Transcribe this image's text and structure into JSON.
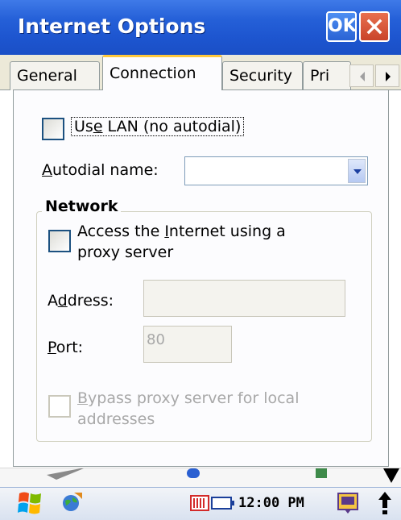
{
  "window": {
    "title": "Internet Options",
    "ok_label": "OK"
  },
  "tabs": [
    {
      "label": "General",
      "active": false
    },
    {
      "label": "Connection",
      "active": true
    },
    {
      "label": "Security",
      "active": false
    },
    {
      "label": "Pri",
      "active": false
    }
  ],
  "connection": {
    "use_lan": {
      "prefix": "Us",
      "mnemonic": "e",
      "suffix": " LAN (no autodial)",
      "checked": false
    },
    "autodial": {
      "mnemonic": "A",
      "suffix": "utodial name:",
      "value": ""
    },
    "network": {
      "group_title": "Network",
      "proxy_checkbox": {
        "line1_prefix": "Access the ",
        "mnemonic": "I",
        "line1_suffix": "nternet using a",
        "line2": "proxy server",
        "checked": false
      },
      "address": {
        "prefix": "A",
        "mnemonic": "d",
        "suffix": "dress:",
        "value": ""
      },
      "port": {
        "mnemonic": "P",
        "suffix": "ort:",
        "value": "80"
      },
      "bypass": {
        "mnemonic": "B",
        "line1_suffix": "ypass proxy server for local",
        "line2": "addresses",
        "checked": false
      }
    }
  },
  "taskbar": {
    "time": "12:00 PM"
  },
  "colors": {
    "titlebar": "#2560d8",
    "tab_highlight": "#ffc83c",
    "close_button": "#c9442a",
    "checkbox_border": "#1c5180",
    "disabled_text": "#a8a8a8"
  }
}
